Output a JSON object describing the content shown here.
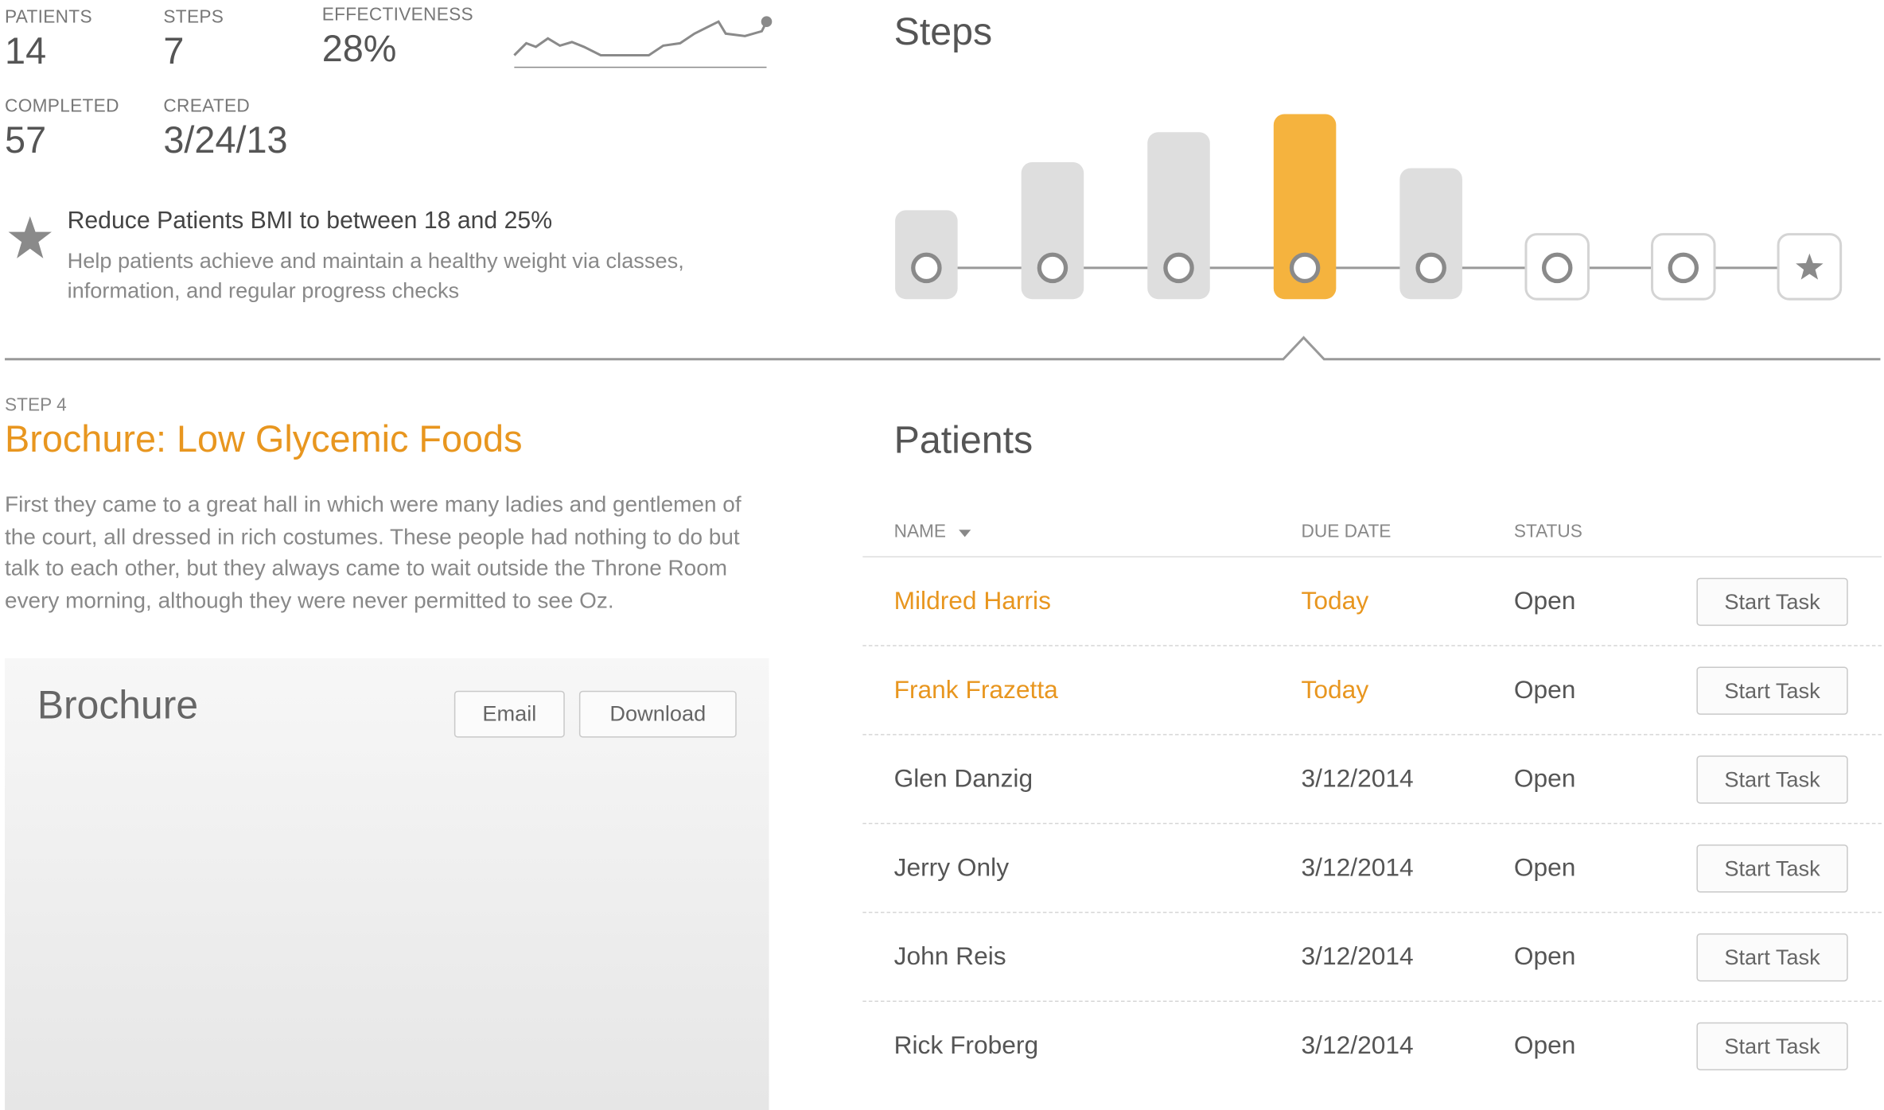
{
  "stats": {
    "patients": {
      "label": "PATIENTS",
      "value": "14"
    },
    "steps": {
      "label": "STEPS",
      "value": "7"
    },
    "effectiveness": {
      "label": "EFFECTIVENESS",
      "value": "28%"
    },
    "completed": {
      "label": "COMPLETED",
      "value": "57"
    },
    "created": {
      "label": "CREATED",
      "value": "3/24/13"
    }
  },
  "goal": {
    "icon": "star-icon",
    "title": "Reduce Patients BMI to between 18 and 25%",
    "description": "Help patients achieve and maintain a healthy weight via classes, information, and regular progress checks"
  },
  "steps_panel": {
    "heading": "Steps",
    "selected_step": 4,
    "nodes": [
      {
        "step": 1,
        "type": "circle",
        "level": 0.2
      },
      {
        "step": 2,
        "type": "circle",
        "level": 0.6
      },
      {
        "step": 3,
        "type": "circle",
        "level": 0.85
      },
      {
        "step": 4,
        "type": "circle",
        "level": 1.0
      },
      {
        "step": 5,
        "type": "circle",
        "level": 0.55
      },
      {
        "step": 6,
        "type": "circle",
        "level": 0
      },
      {
        "step": 7,
        "type": "circle",
        "level": 0
      },
      {
        "step": 8,
        "type": "star",
        "level": 0
      }
    ]
  },
  "current_step": {
    "label": "STEP 4",
    "title": "Brochure: Low Glycemic Foods",
    "description": "First they came to a great hall in which were many ladies and gentlemen of the court, all dressed in rich costumes. These people had nothing to do but talk to each other, but they always came to wait outside the Throne Room every morning, although they were never permitted to see Oz."
  },
  "brochure": {
    "title": "Brochure",
    "email_label": "Email",
    "download_label": "Download"
  },
  "patients": {
    "heading": "Patients",
    "columns": {
      "name": "NAME",
      "due": "DUE DATE",
      "status": "STATUS"
    },
    "rows": [
      {
        "name": "Mildred Harris",
        "due": "Today",
        "status": "Open",
        "action": "Start Task",
        "highlight": true
      },
      {
        "name": "Frank Frazetta",
        "due": "Today",
        "status": "Open",
        "action": "Start Task",
        "highlight": true
      },
      {
        "name": "Glen Danzig",
        "due": "3/12/2014",
        "status": "Open",
        "action": "Start Task",
        "highlight": false
      },
      {
        "name": "Jerry Only",
        "due": "3/12/2014",
        "status": "Open",
        "action": "Start Task",
        "highlight": false
      },
      {
        "name": "John Reis",
        "due": "3/12/2014",
        "status": "Open",
        "action": "Start Task",
        "highlight": false
      },
      {
        "name": "Rick Froberg",
        "due": "3/12/2014",
        "status": "Open",
        "action": "Start Task",
        "highlight": false
      }
    ]
  },
  "colors": {
    "accent": "#e8961f",
    "bar_active": "#f5b33e",
    "bar_inactive": "#dedede"
  }
}
